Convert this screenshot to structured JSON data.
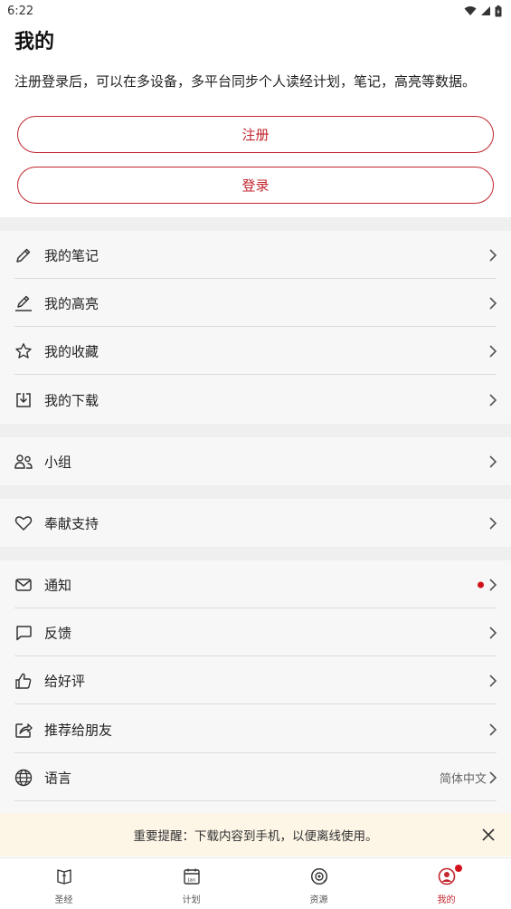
{
  "status_bar": {
    "time": "6:22"
  },
  "header": {
    "title": "我的"
  },
  "intro": "注册登录后，可以在多设备，多平台同步个人读经计划，笔记，高亮等数据。",
  "auth": {
    "register_label": "注册",
    "login_label": "登录"
  },
  "menu": {
    "notes": "我的笔记",
    "highlights": "我的高亮",
    "favorites": "我的收藏",
    "downloads": "我的下载",
    "groups": "小组",
    "donate": "奉献支持",
    "notifications": "通知",
    "feedback": "反馈",
    "rate": "给好评",
    "recommend": "推荐给朋友",
    "language": "语言",
    "language_value": "简体中文"
  },
  "banner": {
    "text": "重要提醒：下载内容到手机，以便离线使用。"
  },
  "tabs": {
    "bible": "圣经",
    "plans": "计划",
    "resources": "资源",
    "me": "我的"
  },
  "colors": {
    "accent": "#c2262e",
    "notification_dot": "#d1111b",
    "banner_bg": "#fdf5e6"
  }
}
